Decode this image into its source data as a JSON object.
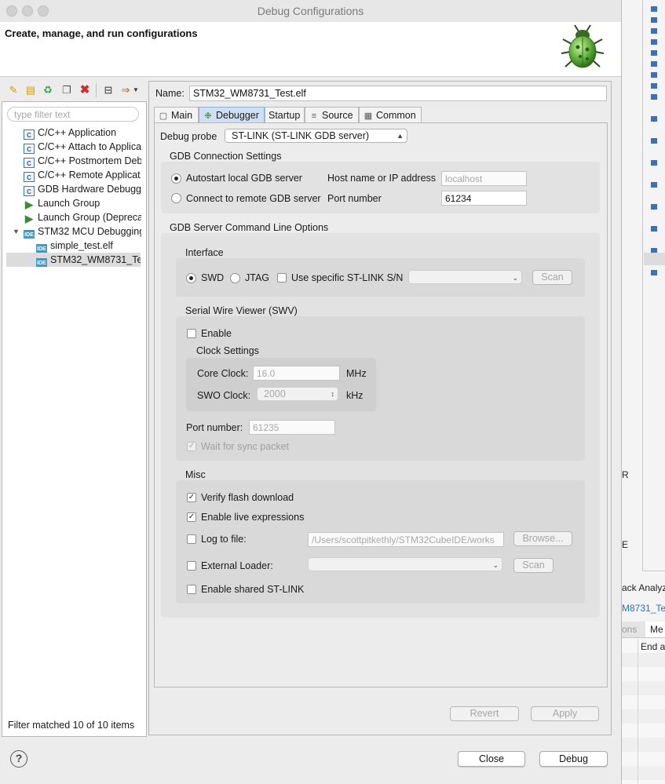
{
  "window": {
    "title": "Debug Configurations"
  },
  "header": {
    "title": "Create, manage, and run configurations"
  },
  "left": {
    "filter_placeholder": "type filter text",
    "tree": [
      {
        "label": "C/C++ Application",
        "icon": "c-config-icon"
      },
      {
        "label": "C/C++ Attach to Applica",
        "icon": "c-config-icon"
      },
      {
        "label": "C/C++ Postmortem Deb",
        "icon": "c-config-icon"
      },
      {
        "label": "C/C++ Remote Applicat",
        "icon": "c-config-icon"
      },
      {
        "label": "GDB Hardware Debuggi",
        "icon": "c-config-icon"
      },
      {
        "label": "Launch Group",
        "icon": "launch-group-icon"
      },
      {
        "label": "Launch Group (Depreca",
        "icon": "launch-group-deprecated-icon"
      },
      {
        "label": "STM32 MCU Debugging",
        "icon": "ide-icon"
      },
      {
        "label": "simple_test.elf",
        "icon": "ide-icon"
      },
      {
        "label": "STM32_WM8731_Tes",
        "icon": "ide-icon"
      }
    ],
    "status": "Filter matched 10 of 10 items"
  },
  "right": {
    "name_label": "Name:",
    "name_value": "STM32_WM8731_Test.elf",
    "tabs": [
      "Main",
      "Debugger",
      "Startup",
      "Source",
      "Common"
    ],
    "active_tab": "Debugger",
    "debugger": {
      "probe_label": "Debug probe",
      "probe_value": "ST-LINK (ST-LINK GDB server)",
      "gdb_conn": {
        "title": "GDB Connection Settings",
        "autostart": "Autostart local GDB server",
        "connect_remote": "Connect to remote GDB server",
        "host_label": "Host name or IP address",
        "host_value": "localhost",
        "port_label": "Port number",
        "port_value": "61234"
      },
      "server_opts": {
        "title": "GDB Server Command Line Options",
        "interface": {
          "title": "Interface",
          "swd": "SWD",
          "jtag": "JTAG",
          "use_sn": "Use specific ST-LINK S/N",
          "scan": "Scan"
        },
        "swv": {
          "title": "Serial Wire Viewer (SWV)",
          "enable": "Enable",
          "clock_title": "Clock Settings",
          "core_label": "Core Clock:",
          "core_value": "16.0",
          "core_unit": "MHz",
          "swo_label": "SWO Clock:",
          "swo_value": "2000",
          "swo_unit": "kHz",
          "port_label": "Port number:",
          "port_value": "61235",
          "wait_sync": "Wait for sync packet"
        },
        "misc": {
          "title": "Misc",
          "verify_flash": "Verify flash download",
          "live_expr": "Enable live expressions",
          "log_file": "Log to file:",
          "log_path": "/Users/scottpitkethly/STM32CubeIDE/works",
          "browse": "Browse...",
          "ext_loader": "External Loader:",
          "scan": "Scan",
          "shared_stlink": "Enable shared ST-LINK"
        }
      }
    },
    "revert": "Revert",
    "apply": "Apply"
  },
  "footer": {
    "close": "Close",
    "debug": "Debug"
  },
  "background_app": {
    "r_letter": "R",
    "e_letter": "E",
    "analyz": "ack Analyz",
    "test_link": "M8731_Tes",
    "tab_ons": "ons",
    "tab_me": "Me",
    "end_a": "End a"
  },
  "colors": {
    "accent": "#2e9fd8",
    "tab_active": "#cfe0f5"
  }
}
